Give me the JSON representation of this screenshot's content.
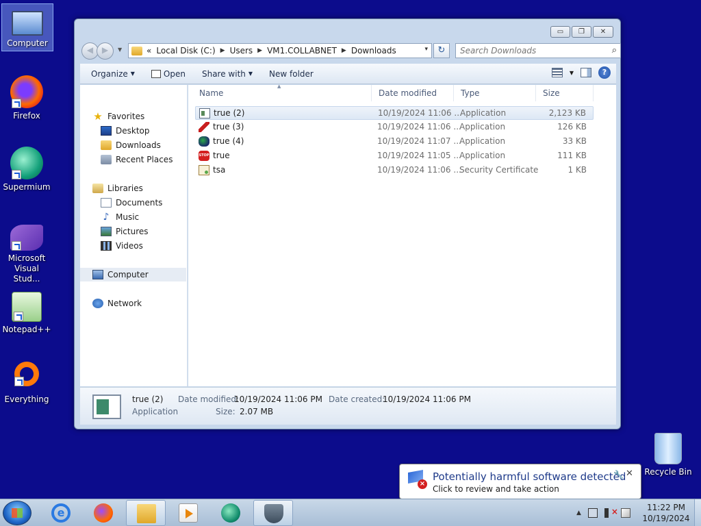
{
  "desktop": {
    "icons": [
      {
        "label": "Computer"
      },
      {
        "label": "Firefox"
      },
      {
        "label": "Supermium"
      },
      {
        "label": "Microsoft Visual Stud..."
      },
      {
        "label": "Notepad++"
      },
      {
        "label": "Everything"
      }
    ],
    "recycle_bin": "Recycle Bin"
  },
  "explorer": {
    "caption": {
      "minimize": "▭",
      "maximize": "❐",
      "close": "✕"
    },
    "address": {
      "history": "«",
      "crumbs": [
        "Local Disk (C:)",
        "Users",
        "VM1.COLLABNET",
        "Downloads"
      ],
      "separator": "▶",
      "dropdown": "▾",
      "refresh": "↻"
    },
    "search": {
      "placeholder": "Search Downloads"
    },
    "toolbar": {
      "organize": "Organize",
      "open": "Open",
      "share_with": "Share with",
      "new_folder": "New folder",
      "help": "?"
    },
    "nav": {
      "favorites": "Favorites",
      "desktop": "Desktop",
      "downloads": "Downloads",
      "recent_places": "Recent Places",
      "libraries": "Libraries",
      "documents": "Documents",
      "music": "Music",
      "pictures": "Pictures",
      "videos": "Videos",
      "computer": "Computer",
      "network": "Network"
    },
    "columns": {
      "name": "Name",
      "date_modified": "Date modified",
      "type": "Type",
      "size": "Size"
    },
    "files": [
      {
        "name": "true (2)",
        "date": "10/19/2024 11:06 ...",
        "type": "Application",
        "size": "2,123 KB"
      },
      {
        "name": "true (3)",
        "date": "10/19/2024 11:06 ...",
        "type": "Application",
        "size": "126 KB"
      },
      {
        "name": "true (4)",
        "date": "10/19/2024 11:07 ...",
        "type": "Application",
        "size": "33 KB"
      },
      {
        "name": "true",
        "date": "10/19/2024 11:05 ...",
        "type": "Application",
        "size": "111 KB"
      },
      {
        "name": "tsa",
        "date": "10/19/2024 11:06 ...",
        "type": "Security Certificate",
        "size": "1 KB"
      }
    ],
    "details": {
      "name": "true (2)",
      "kind": "Application",
      "date_modified_label": "Date modified:",
      "date_modified": "10/19/2024 11:06 PM",
      "date_created_label": "Date created:",
      "date_created": "10/19/2024 11:06 PM",
      "size_label": "Size:",
      "size": "2.07 MB"
    }
  },
  "notification": {
    "title": "Potentially harmful software detected",
    "subtitle": "Click to review and take action",
    "options": "🔧",
    "close": "✕"
  },
  "taskbar": {
    "ie_glyph": "e",
    "tray_up": "▲",
    "time": "11:22 PM",
    "date": "10/19/2024"
  },
  "colors": {
    "desktop": "#0c0c8c",
    "accent": "#1e3a8a"
  }
}
